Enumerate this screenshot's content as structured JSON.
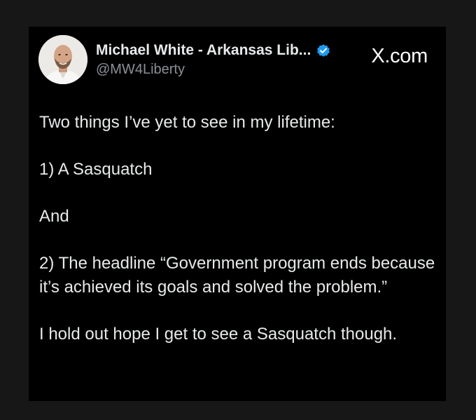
{
  "post": {
    "display_name": "Michael White - Arkansas Lib...",
    "handle": "@MW4Liberty",
    "brand": "X.com",
    "verified_badge_icon": "verified-badge-icon",
    "avatar_icon": "profile-avatar",
    "text": {
      "p1": "Two things I’ve yet to see in my lifetime:",
      "p2": "1) A Sasquatch",
      "p3": "And",
      "p4": "2) The headline “Government program ends because it’s achieved its goals and solved the problem.”",
      "p5": "I hold out hope I get to see a Sasquatch though."
    }
  },
  "colors": {
    "background": "#171717",
    "card": "#000000",
    "text": "#e7e9ea",
    "handle": "#8b9095",
    "verified": "#1d9bf0"
  }
}
